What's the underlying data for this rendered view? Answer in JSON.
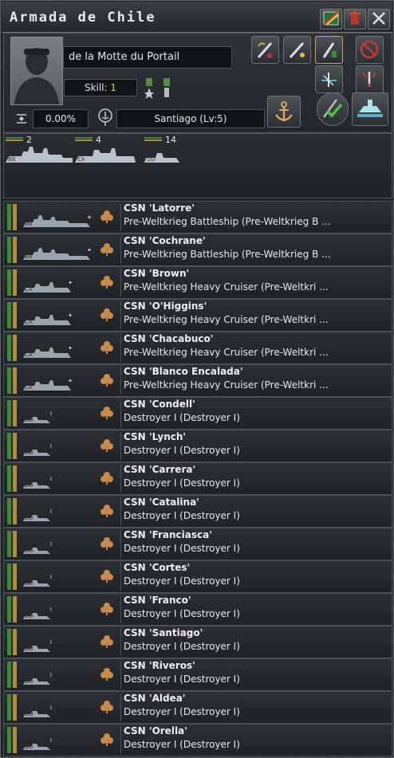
{
  "window": {
    "title": "Armada de Chile"
  },
  "leader": {
    "name": "de la Motte du Portail",
    "skill_label": "Skill:",
    "skill_value": "1",
    "experience": "0.00%",
    "base": "Santiago (Lv:5)"
  },
  "summary": [
    {
      "type": "BB",
      "count": "2"
    },
    {
      "type": "CA",
      "count": "4"
    },
    {
      "type": "DD",
      "count": "14"
    }
  ],
  "ships": [
    {
      "name": "CSN 'Latorre'",
      "class": "Pre-Weltkrieg Battleship (Pre-Weltkrieg B ...",
      "type": "BB",
      "org": 1.0,
      "strength": 1.0
    },
    {
      "name": "CSN 'Cochrane'",
      "class": "Pre-Weltkrieg Battleship (Pre-Weltkrieg B ...",
      "type": "BB",
      "org": 1.0,
      "strength": 1.0
    },
    {
      "name": "CSN 'Brown'",
      "class": "Pre-Weltkrieg Heavy Cruiser (Pre-Weltkri ...",
      "type": "CA",
      "org": 1.0,
      "strength": 1.0
    },
    {
      "name": "CSN 'O'Higgins'",
      "class": "Pre-Weltkrieg Heavy Cruiser (Pre-Weltkri ...",
      "type": "CA",
      "org": 1.0,
      "strength": 1.0
    },
    {
      "name": "CSN 'Chacabuco'",
      "class": "Pre-Weltkrieg Heavy Cruiser (Pre-Weltkri ...",
      "type": "CA",
      "org": 1.0,
      "strength": 1.0
    },
    {
      "name": "CSN 'Blanco Encalada'",
      "class": "Pre-Weltkrieg Heavy Cruiser (Pre-Weltkri ...",
      "type": "CA",
      "org": 1.0,
      "strength": 1.0
    },
    {
      "name": "CSN 'Condell'",
      "class": "Destroyer I (Destroyer I)",
      "type": "DD",
      "org": 1.0,
      "strength": 1.0
    },
    {
      "name": "CSN 'Lynch'",
      "class": "Destroyer I (Destroyer I)",
      "type": "DD",
      "org": 1.0,
      "strength": 1.0
    },
    {
      "name": "CSN 'Carrera'",
      "class": "Destroyer I (Destroyer I)",
      "type": "DD",
      "org": 1.0,
      "strength": 1.0
    },
    {
      "name": "CSN 'Catalina'",
      "class": "Destroyer I (Destroyer I)",
      "type": "DD",
      "org": 1.0,
      "strength": 1.0
    },
    {
      "name": "CSN 'Franciasca'",
      "class": "Destroyer I (Destroyer I)",
      "type": "DD",
      "org": 1.0,
      "strength": 1.0
    },
    {
      "name": "CSN 'Cortes'",
      "class": "Destroyer I (Destroyer I)",
      "type": "DD",
      "org": 1.0,
      "strength": 1.0
    },
    {
      "name": "CSN 'Franco'",
      "class": "Destroyer I (Destroyer I)",
      "type": "DD",
      "org": 1.0,
      "strength": 1.0
    },
    {
      "name": "CSN 'Santiago'",
      "class": "Destroyer I (Destroyer I)",
      "type": "DD",
      "org": 1.0,
      "strength": 1.0
    },
    {
      "name": "CSN 'Riveros'",
      "class": "Destroyer I (Destroyer I)",
      "type": "DD",
      "org": 1.0,
      "strength": 1.0
    },
    {
      "name": "CSN 'Aldea'",
      "class": "Destroyer I (Destroyer I)",
      "type": "DD",
      "org": 1.0,
      "strength": 1.0
    },
    {
      "name": "CSN 'Orella'",
      "class": "Destroyer I (Destroyer I)",
      "type": "DD",
      "org": 1.0,
      "strength": 1.0
    }
  ]
}
